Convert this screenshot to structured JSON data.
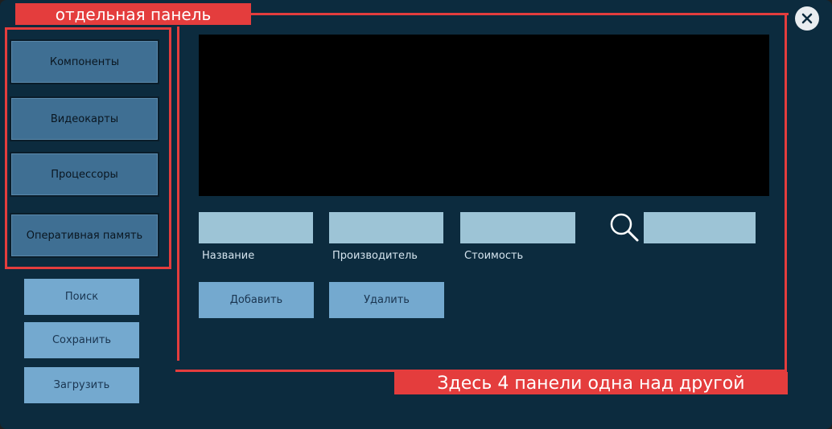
{
  "nav": {
    "items": [
      {
        "label": "Компоненты"
      },
      {
        "label": "Видеокарты"
      },
      {
        "label": "Процессоры"
      },
      {
        "label": "Оперативная память"
      }
    ]
  },
  "actions": {
    "search_label": "Поиск",
    "save_label": "Сохранить",
    "load_label": "Загрузить"
  },
  "form": {
    "fields": [
      {
        "label": "Название",
        "value": ""
      },
      {
        "label": "Производитель",
        "value": ""
      },
      {
        "label": "Стоимость",
        "value": ""
      }
    ],
    "search_value": "",
    "add_label": "Добавить",
    "delete_label": "Удалить"
  },
  "annotations": {
    "separate_panel": "отдельная панель",
    "four_panels": "Здесь 4 панели одна над другой"
  },
  "colors": {
    "window_bg": "#0c2b3e",
    "nav_button": "#3f6f93",
    "action_button": "#74a9cf",
    "field_bg": "#9dc4d6",
    "annotation": "#e43d3d"
  },
  "icons": {
    "search": "search-icon",
    "close": "close-icon"
  }
}
